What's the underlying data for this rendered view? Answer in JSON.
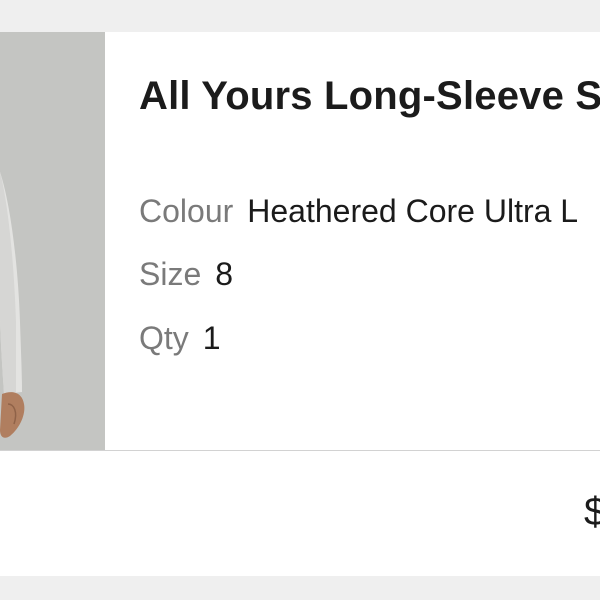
{
  "product": {
    "title": "All Yours Long-Sleeve S",
    "colour_label": "Colour",
    "colour_value": "Heathered Core Ultra L",
    "size_label": "Size",
    "size_value": "8",
    "qty_label": "Qty",
    "qty_value": "1",
    "price": "$"
  },
  "colors": {
    "background": "#efefef",
    "card": "#ffffff",
    "title_text": "#1b1b1b",
    "label_text": "#7a7a7a",
    "photo_backdrop": "#c4c5c2"
  },
  "icons": {
    "product_image": "product-thumbnail-photo"
  }
}
